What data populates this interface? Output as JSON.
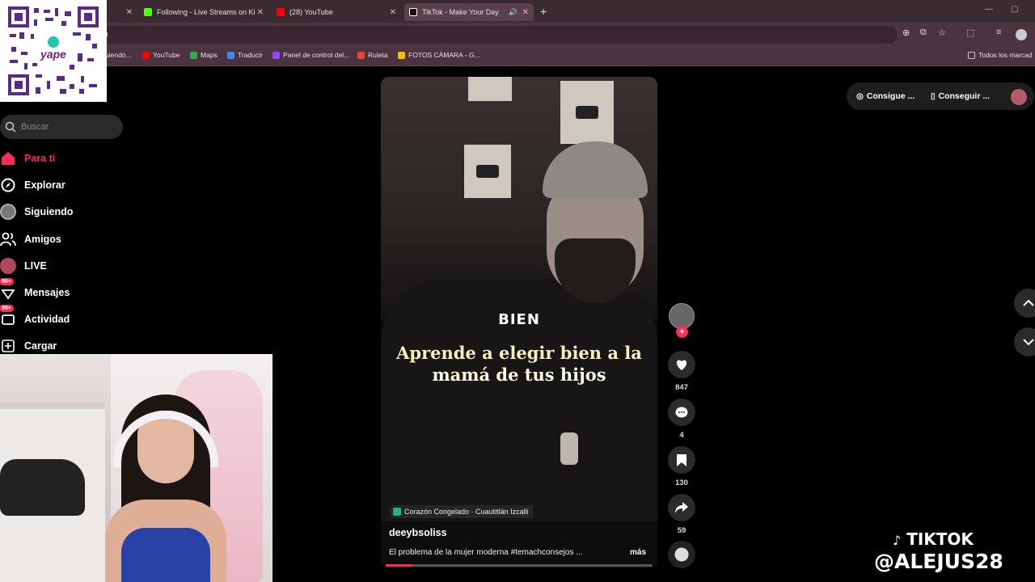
{
  "browser": {
    "tabs": [
      {
        "title": "",
        "favicon_color": "#6b6b6b"
      },
      {
        "title": "Following - Live Streams on Ki",
        "favicon_color": "#53fc18"
      },
      {
        "title": "(28) YouTube",
        "favicon_color": "#ff0000"
      },
      {
        "title": "TikTok - Make Your Day",
        "favicon_color": "#ffffff"
      }
    ],
    "new_tab": "+",
    "url": "n",
    "bookmarks": [
      {
        "label": "uiendo...",
        "color": "#9a9a9a"
      },
      {
        "label": "YouTube",
        "color": "#ff0000"
      },
      {
        "label": "Maps",
        "color": "#34a853"
      },
      {
        "label": "Traducir",
        "color": "#4285f4"
      },
      {
        "label": "Panel de control del...",
        "color": "#9146ff"
      },
      {
        "label": "Ruleta",
        "color": "#ea4335"
      },
      {
        "label": "FOTOS CÁMARA - G...",
        "color": "#fbbc05"
      }
    ],
    "all_bookmarks": "Todos los marcad"
  },
  "qr": {
    "brand": "yape"
  },
  "sidebar": {
    "search_placeholder": "Buscar",
    "items": [
      {
        "label": "Para ti",
        "icon": "home-icon",
        "active": true
      },
      {
        "label": "Explorar",
        "icon": "compass-icon"
      },
      {
        "label": "Siguiendo",
        "icon": "following-avatar"
      },
      {
        "label": "Amigos",
        "icon": "friends-icon"
      },
      {
        "label": "LIVE",
        "icon": "live-avatar"
      },
      {
        "label": "Mensajes",
        "icon": "messages-icon",
        "badge": "99+"
      },
      {
        "label": "Actividad",
        "icon": "activity-icon",
        "badge": "99+"
      },
      {
        "label": "Cargar",
        "icon": "upload-icon"
      }
    ]
  },
  "video": {
    "caption_top": "BIEN",
    "caption_main_line1": "Aprende a elegir bien a la",
    "caption_main_line2": "mamá de tus hijos",
    "location": "Corazón Congelado · Cuautitlán Izcalli",
    "author": "deeybsoliss",
    "description": "El problema de la mujer moderna #temachconsejos ...",
    "more": "más",
    "progress": 0.1
  },
  "actions": {
    "likes": "847",
    "comments": "4",
    "saves": "130",
    "shares": "59"
  },
  "topright": {
    "get_coins": "Consigue ...",
    "get_app": "Conseguir ..."
  },
  "watermark": {
    "line1": "TIKTOK",
    "line2": "@ALEJUS28"
  },
  "colors": {
    "accent": "#fe2c55"
  }
}
